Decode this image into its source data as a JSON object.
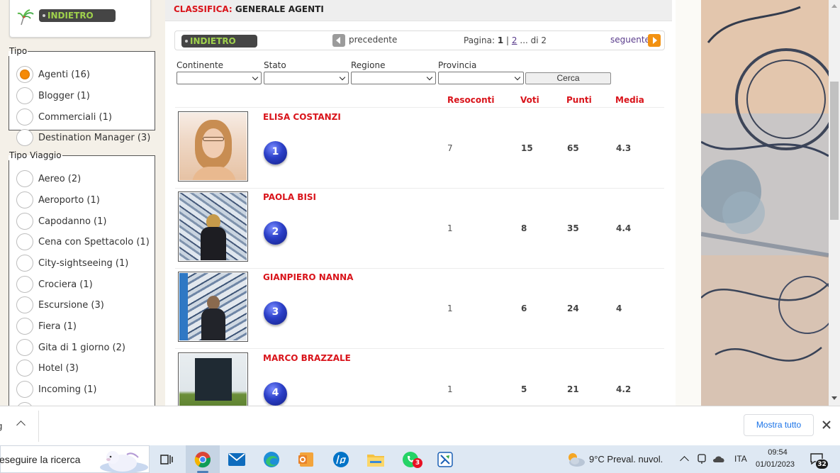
{
  "sidebar": {
    "back_label": "INDIETRO",
    "tipo": {
      "legend": "Tipo",
      "options": [
        {
          "label": "Agenti (16)",
          "checked": true
        },
        {
          "label": "Blogger (1)",
          "checked": false
        },
        {
          "label": "Commerciali (1)",
          "checked": false
        },
        {
          "label": "Destination Manager (3)",
          "checked": false
        }
      ]
    },
    "tipo_viaggio": {
      "legend": "Tipo Viaggio",
      "options": [
        {
          "label": "Aereo (2)"
        },
        {
          "label": "Aeroporto (1)"
        },
        {
          "label": "Capodanno (1)"
        },
        {
          "label": "Cena con Spettacolo (1)"
        },
        {
          "label": "City-sightseeing (1)"
        },
        {
          "label": "Crociera (1)"
        },
        {
          "label": "Escursione (3)"
        },
        {
          "label": "Fiera (1)"
        },
        {
          "label": "Gita di 1 giorno (2)"
        },
        {
          "label": "Hotel (3)"
        },
        {
          "label": "Incoming (1)"
        }
      ]
    }
  },
  "header": {
    "title_prefix": "CLASSIFICA:",
    "title_main": "GENERALE AGENTI"
  },
  "pager": {
    "back_label": "INDIETRO",
    "prev_label": "precedente",
    "page_word": "Pagina:",
    "current_page": "1",
    "separator": "|",
    "next_page_link": "2",
    "ellipsis_total": "... di 2",
    "next_label": "seguente"
  },
  "filters": {
    "continente": "Continente",
    "stato": "Stato",
    "regione": "Regione",
    "provincia": "Provincia",
    "search_button": "Cerca"
  },
  "table": {
    "headers": {
      "resoconti": "Resoconti",
      "voti": "Voti",
      "punti": "Punti",
      "media": "Media"
    },
    "rows": [
      {
        "name": "ELISA COSTANZI",
        "rank": "1",
        "resoconti": "7",
        "voti": "15",
        "punti": "65",
        "media": "4.3"
      },
      {
        "name": "PAOLA BISI",
        "rank": "2",
        "resoconti": "1",
        "voti": "8",
        "punti": "35",
        "media": "4.4"
      },
      {
        "name": "GIANPIERO NANNA",
        "rank": "3",
        "resoconti": "1",
        "voti": "6",
        "punti": "24",
        "media": "4"
      },
      {
        "name": "MARCO BRAZZALE",
        "rank": "4",
        "resoconti": "1",
        "voti": "5",
        "punti": "21",
        "media": "4.2"
      }
    ]
  },
  "download_bar": {
    "item_fragment": "g",
    "show_all": "Mostra tutto"
  },
  "taskbar": {
    "search_text": "eseguire la ricerca",
    "whatsapp_badge": "3",
    "weather": "9°C  Preval. nuvol.",
    "language": "ITA",
    "time": "09:54",
    "date": "01/01/2023",
    "notifications": "32"
  },
  "colors": {
    "accent_red": "#d9141b",
    "radio_checked": "#f58a07",
    "pill_bg": "#454545",
    "pill_text": "#9fd14c",
    "rank_blue": "#2b3fc7",
    "link_purple": "#5a3c8c"
  }
}
